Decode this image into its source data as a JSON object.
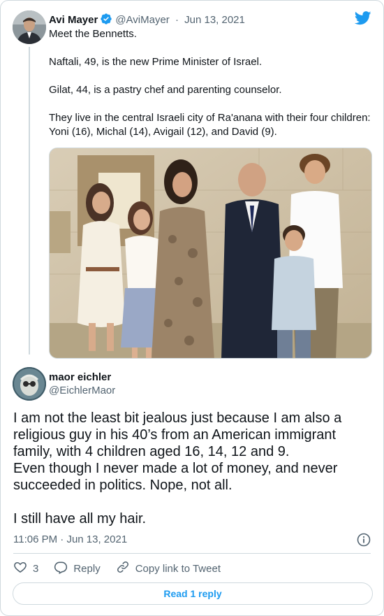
{
  "parent_tweet": {
    "author_name": "Avi Mayer",
    "author_handle": "@AviMayer",
    "separator": "·",
    "date": "Jun 13, 2021",
    "lines": [
      "Meet the Bennetts.",
      "Naftali, 49, is the new Prime Minister of Israel.",
      "Gilat, 44, is a pastry chef and parenting counselor.",
      "They live in the central Israeli city of Ra'anana with their four children:",
      "Yoni (16), Michal (14), Avigail (12), and David (9)."
    ],
    "icons": {
      "verified": "verified-badge-icon",
      "logo": "twitter-bird-icon"
    },
    "colors": {
      "verified": "#1d9bf0",
      "logo": "#1d9bf0"
    }
  },
  "reply_tweet": {
    "author_name": "maor eichler",
    "author_handle": "@EichlerMaor",
    "lines": [
      "I am not the least bit jealous just because I am also a",
      "religious guy in his 40’s from an American immigrant",
      "family, with 4 children aged 16, 14, 12 and 9.",
      "Even though I never made a lot of money, and never",
      "succeeded in politics. Nope, not all.",
      "I still have all my hair."
    ],
    "time": "11:06 PM",
    "date": "Jun 13, 2021",
    "separator": "·"
  },
  "actions": {
    "like_count": "3",
    "reply_label": "Reply",
    "copy_link_label": "Copy link to Tweet",
    "read_replies_label": "Read 1 reply",
    "icons": [
      "heart-icon",
      "reply-icon",
      "link-icon",
      "info-icon"
    ]
  },
  "colors": {
    "text": "#0f1419",
    "muted": "#536471",
    "border": "#cfd9de",
    "accent": "#1d9bf0"
  }
}
